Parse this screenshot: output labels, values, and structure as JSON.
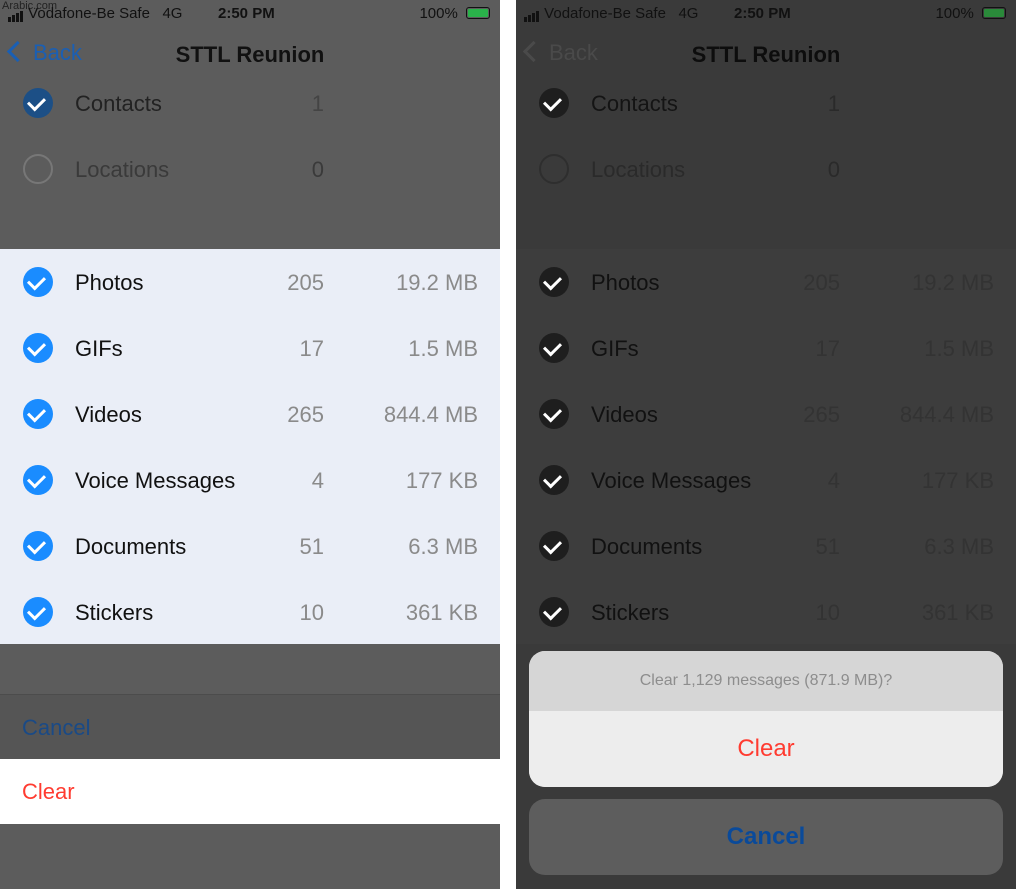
{
  "watermark": "Arabic.com",
  "status": {
    "carrier": "Vodafone-Be Safe",
    "network": "4G",
    "time": "2:50 PM",
    "battery": "100%"
  },
  "nav": {
    "back": "Back",
    "title": "STTL Reunion"
  },
  "top_rows": [
    {
      "label": "Contacts",
      "count": "1",
      "checked": true
    },
    {
      "label": "Locations",
      "count": "0",
      "checked": false
    }
  ],
  "media_rows": [
    {
      "label": "Photos",
      "count": "205",
      "size": "19.2 MB"
    },
    {
      "label": "GIFs",
      "count": "17",
      "size": "1.5 MB"
    },
    {
      "label": "Videos",
      "count": "265",
      "size": "844.4 MB"
    },
    {
      "label": "Voice Messages",
      "count": "4",
      "size": "177 KB"
    },
    {
      "label": "Documents",
      "count": "51",
      "size": "6.3 MB"
    },
    {
      "label": "Stickers",
      "count": "10",
      "size": "361 KB"
    }
  ],
  "actions": {
    "cancel": "Cancel",
    "clear": "Clear"
  },
  "alert": {
    "message": "Clear 1,129 messages (871.9 MB)?",
    "clear": "Clear",
    "cancel": "Cancel"
  },
  "colors": {
    "accent": "#1a8cff",
    "destructive": "#ff3b30",
    "list_bg": "#eaeef7"
  },
  "icons": [
    "signal-icon",
    "battery-icon",
    "chevron-left-icon",
    "checkmark-icon"
  ]
}
